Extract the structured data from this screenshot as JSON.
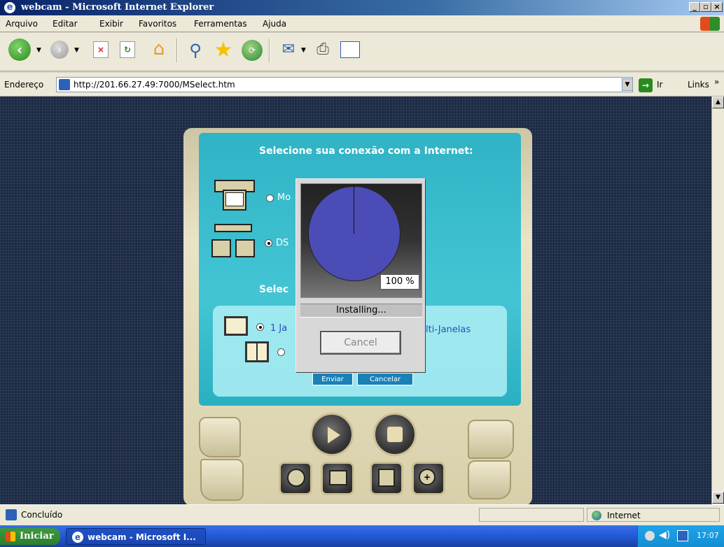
{
  "window": {
    "title": "webcam - Microsoft Internet Explorer"
  },
  "menu": [
    "Arquivo",
    "Editar",
    "Exibir",
    "Favoritos",
    "Ferramentas",
    "Ajuda"
  ],
  "address": {
    "label": "Endereço",
    "url": "http://201.66.27.49:7000/MSelect.htm",
    "go_label": "Ir",
    "links_label": "Links"
  },
  "page": {
    "connection_heading": "Selecione sua conexão com a Internet:",
    "option_modem": "Mo",
    "option_dsl": "DS",
    "select_prefix": "Selec",
    "option_1ja": "1 Ja",
    "option_multi": "lti-Janelas",
    "send_button": "Enviar",
    "cancel_button": "Cancelar"
  },
  "install_dialog": {
    "progress_label": "100 %",
    "progress": 100,
    "status": "Installing...",
    "cancel_label": "Cancel"
  },
  "status": {
    "text": "Concluído",
    "zone": "Internet"
  },
  "taskbar": {
    "start_label": "Iniciar",
    "task_label": "webcam - Microsoft I...",
    "clock": "17:07"
  }
}
